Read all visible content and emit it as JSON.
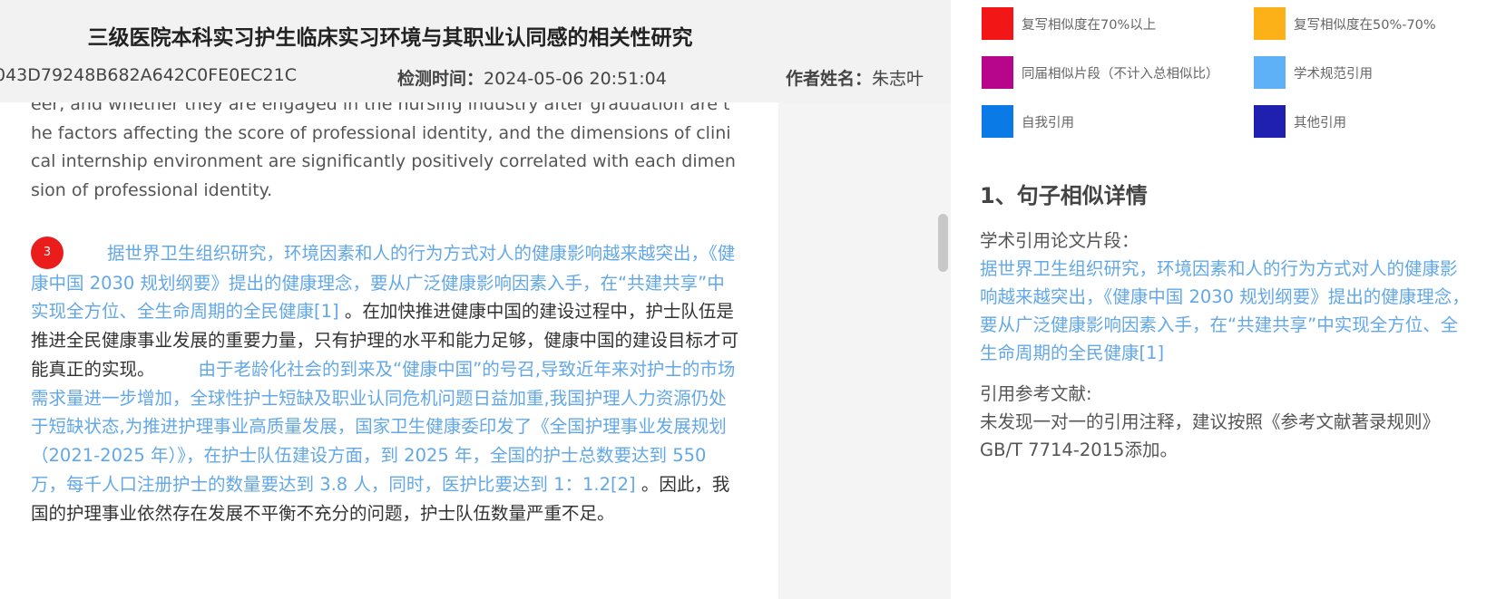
{
  "header": {
    "title": "三级医院本科实习护生临床实习环境与其职业认同感的相关性研究",
    "report_id": "043D79248B682A642C0FE0EC21C",
    "check_time_label": "检测时间：",
    "check_time": "2024-05-06 20:51:04",
    "author_label": "作者姓名：",
    "author": "朱志叶"
  },
  "document": {
    "abstract_text": "eer, and whether they are engaged in the nursing industry after graduation are the factors affecting the score of professional identity, and the dimensions of clinical internship environment are significantly positively correlated with each dimension of professional identity.",
    "paragraph": {
      "badge": "3",
      "seg1": "据世界卫生组织研究，环境因素和人的行为方式对人的健康影响越来越突出，《健康中国 2030 规划纲要》提出的健康理念，要从广泛健康影响因素入手，在“共建共享”中实现全方位、全生命周期的全民健康[1]",
      "seg2": " 。在加快推进健康中国的建设过程中，护士队伍是推进全民健康事业发展的重要力量，只有护理的水平和能力足够，健康中国的建设目标才可能真正的实现。",
      "seg3": "由于老龄化社会的到来及“健康中国”的号召,导致近年来对护士的市场需求量进一步增加，全球性护士短缺及职业认同危机问题日益加重,我国护理人力资源仍处于短缺状态,为推进护理事业高质量发展，国家卫生健康委印发了《全国护理事业发展规划（2021-2025 年）》，在护士队伍建设方面，到 2025 年，全国的护士总数要达到 550 万，每千人口注册护士的数量要达到 3.8 人，同时，医护比要达到 1：1.2[2]",
      "seg4": " 。因此，我国的护理事业依然存在发展不平衡不充分的问题，护士队伍数量严重不足。"
    }
  },
  "legend": [
    {
      "label": "复写相似度在70%以上",
      "color": "#f31616"
    },
    {
      "label": "复写相似度在50%-70%",
      "color": "#fbb117"
    },
    {
      "label": "同届相似片段（不计入总相似比）",
      "color": "#b7068b"
    },
    {
      "label": "学术规范引用",
      "color": "#5eb0f7"
    },
    {
      "label": "自我引用",
      "color": "#0a7be6"
    },
    {
      "label": "其他引用",
      "color": "#1f1fb0"
    }
  ],
  "detail": {
    "section_title": "1、句子相似详情",
    "excerpt_label": "学术引用论文片段：",
    "excerpt_text": "据世界卫生组织研究，环境因素和人的行为方式对人的健康影响越来越突出，《健康中国 2030 规划纲要》提出的健康理念，要从广泛健康影响因素入手，在“共建共享”中实现全方位、全生命周期的全民健康[1]",
    "ref_label": "引用参考文献:",
    "ref_text": "未发现一对一的引用注释，建议按照《参考文献著录规则》GB/T 7714-2015添加。"
  }
}
